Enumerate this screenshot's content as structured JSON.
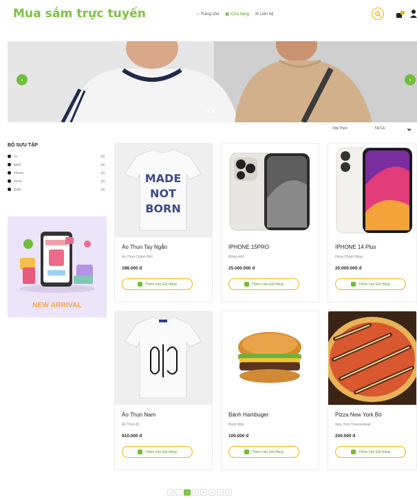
{
  "header": {
    "brand": "Mua sắm trực tuyến",
    "nav": [
      {
        "icon": "home-icon",
        "label": "Trang chủ"
      },
      {
        "icon": "store-icon",
        "label": "Cửa hàng"
      },
      {
        "icon": "mail-icon",
        "label": "Liên hệ"
      }
    ],
    "actions": [
      "search-icon",
      "cart-icon",
      "user-icon"
    ]
  },
  "banner": {
    "prev_label": "‹",
    "next_label": "›"
  },
  "sort": {
    "label": "Xếp Theo",
    "value": "Tất Cả"
  },
  "sidebar": {
    "collection_title": "BỘ SƯU TẬP",
    "categories": [
      {
        "name": "Áo",
        "count": "(3)"
      },
      {
        "name": "Bánh",
        "count": "(3)"
      },
      {
        "name": "iPhone",
        "count": "(3)"
      },
      {
        "name": "Pizza",
        "count": "(3)"
      },
      {
        "name": "Quần",
        "count": "(3)"
      }
    ],
    "promo_text": "NEW ARRIVAL"
  },
  "products": [
    {
      "name": "Áo Thun Tay Ngắn",
      "desc": "Áo Thun Cotton Mới",
      "price": "198.000 đ",
      "button": "Thêm Vào Giỏ Hàng"
    },
    {
      "name": "IPHONE 15PRO",
      "desc": "Đồng mới",
      "price": "25.000.000 đ",
      "button": "Thêm Vào Giỏ Hàng"
    },
    {
      "name": "IPHONE 14 Plus",
      "desc": "Hàng Chính Hãng",
      "price": "20.000.000 đ",
      "button": "Thêm Vào Giỏ Hàng"
    },
    {
      "name": "Áo Thun Nam",
      "desc": "Áo Thun A1",
      "price": "810.000 đ",
      "button": "Thêm Vào Giỏ Hàng"
    },
    {
      "name": "Bánh Hambuger",
      "desc": "Bánh Mặn",
      "price": "100.000 đ",
      "button": "Thêm Vào Giỏ Hàng"
    },
    {
      "name": "Pizza New York Bò",
      "desc": "New York Cheesesteak",
      "price": "200.000 đ",
      "button": "Thêm Vào Giỏ Hàng"
    }
  ],
  "product_images": {
    "tshirt_print": [
      "MADE",
      "NOT",
      "BORN"
    ]
  },
  "pagination": {
    "items": [
      "«",
      "‹",
      "1",
      "2",
      "3",
      "4",
      "›",
      "»"
    ],
    "active": "1"
  },
  "colors": {
    "brand_green": "#7cc242",
    "accent_yellow": "#f0b400"
  }
}
